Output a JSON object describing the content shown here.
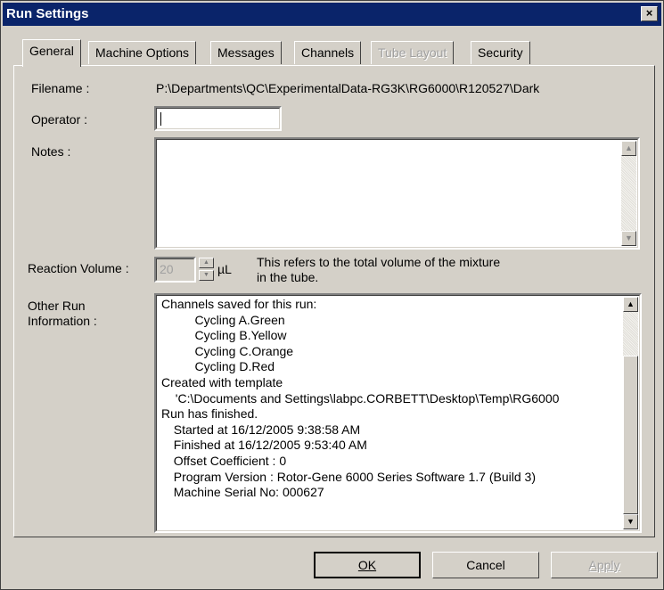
{
  "window": {
    "title": "Run Settings",
    "close_glyph": "×"
  },
  "tabs": [
    {
      "label": "General",
      "active": true
    },
    {
      "label": "Machine Options"
    },
    {
      "label": "Messages"
    },
    {
      "label": "Channels"
    },
    {
      "label": "Tube Layout",
      "disabled": true
    },
    {
      "label": "Security"
    }
  ],
  "general": {
    "filename_label": "Filename :",
    "filename_value": "P:\\Departments\\QC\\ExperimentalData-RG3K\\RG6000\\R120527\\Dark",
    "operator_label": "Operator :",
    "operator_value": "",
    "notes_label": "Notes :",
    "notes_value": "",
    "reaction_volume_label": "Reaction Volume :",
    "reaction_volume_value": "20",
    "reaction_volume_unit": "µL",
    "reaction_volume_hint_1": "This refers to the total volume of the mixture",
    "reaction_volume_hint_2": "in the tube.",
    "other_info_label_1": "Other Run",
    "other_info_label_2": "Information :",
    "other_info_lines": [
      "Channels saved for this run:",
      "    Cycling A.Green",
      "    Cycling B.Yellow",
      "    Cycling C.Orange",
      "    Cycling D.Red",
      "Created with template",
      "  'C:\\Documents and Settings\\labpc.CORBETT\\Desktop\\Temp\\RG6000",
      "Run has finished.",
      "  Started at 16/12/2005 9:38:58 AM",
      "  Finished at 16/12/2005 9:53:40 AM",
      "  Offset Coefficient : 0",
      "  Program Version : Rotor-Gene 6000 Series Software 1.7 (Build 3)",
      "  Machine Serial No: 000627"
    ]
  },
  "buttons": {
    "ok": "OK",
    "cancel": "Cancel",
    "apply": "Apply"
  }
}
